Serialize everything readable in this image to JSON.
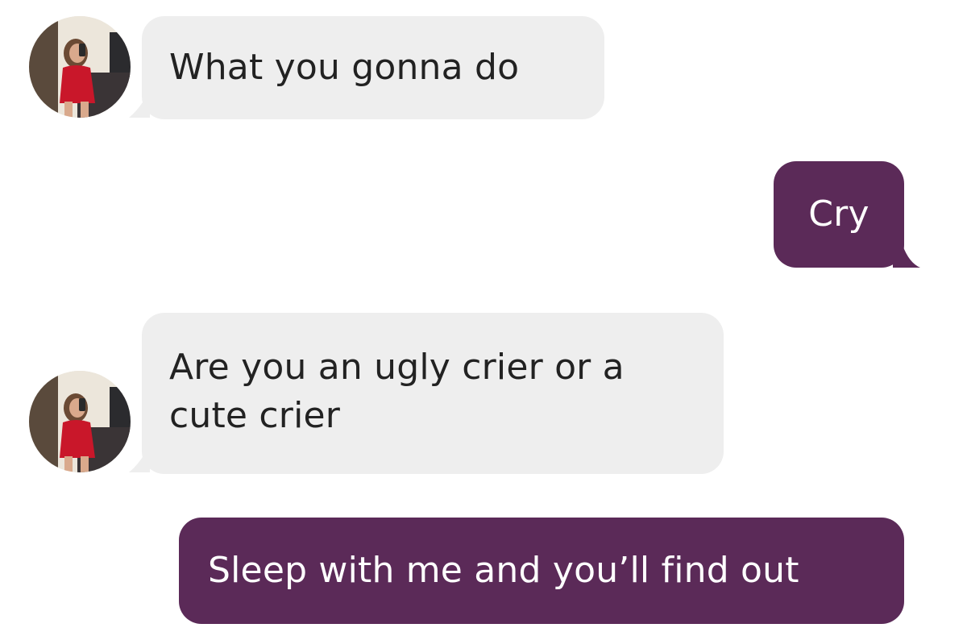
{
  "conversation": {
    "messages": [
      {
        "direction": "incoming",
        "text": "What you gonna do"
      },
      {
        "direction": "outgoing",
        "text": "Cry"
      },
      {
        "direction": "incoming",
        "lines": [
          "Are you an ugly crier or a",
          "cute crier"
        ]
      },
      {
        "direction": "outgoing",
        "text": "Sleep with me and you’ll find out"
      }
    ]
  },
  "colors": {
    "incoming_bubble": "#eeeeee",
    "outgoing_bubble": "#5b2a58",
    "incoming_text": "#222222",
    "outgoing_text": "#ffffff"
  },
  "icons": {
    "avatar": "contact-profile-photo"
  }
}
